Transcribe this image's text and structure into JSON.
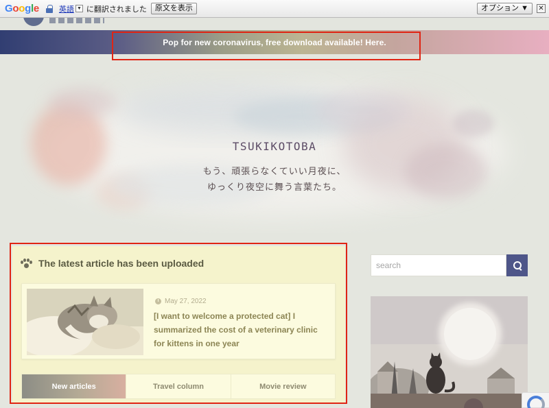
{
  "translate_bar": {
    "logo": "Google",
    "language_link": "英語",
    "dropdown_glyph": "▼",
    "translated_text": "に翻訳されました",
    "show_original_button": "原文を表示",
    "options_button": "オプション ▼",
    "close_glyph": "✕"
  },
  "announcement": {
    "text": "Pop for new coronavirus, free download available! Here."
  },
  "hero": {
    "brand": "TSUKIKOTOBA",
    "tagline_line1": "もう、頑張らなくていい月夜に、",
    "tagline_line2": "ゆっくり夜空に舞う言葉たち。"
  },
  "latest_panel": {
    "icon": "paw-icon",
    "title": "The latest article has been uploaded",
    "article": {
      "date": "May 27, 2022",
      "title": "[I want to welcome a protected cat] I summarized the cost of a veterinary clinic for kittens in one year"
    },
    "tabs": [
      {
        "label": "New articles",
        "active": true
      },
      {
        "label": "Travel column",
        "active": false
      },
      {
        "label": "Movie review",
        "active": false
      }
    ]
  },
  "sidebar": {
    "search_placeholder": "search"
  },
  "colors": {
    "highlight_red": "#e02413",
    "panel_bg": "#f5f3cc",
    "search_button": "#4e5689",
    "banner_start": "#313e72",
    "banner_end": "#e8afc1"
  }
}
